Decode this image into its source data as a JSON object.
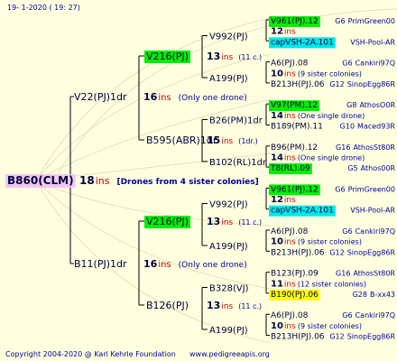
{
  "header": {
    "date": "19-   1-2020  ( 19:  27)"
  },
  "footer": {
    "copyright": "Copyright 2004-2020 @ Karl Kehrle Foundation",
    "url": "www.pedigreeapis.org"
  },
  "colors": {
    "text_dark": "#000040",
    "red": "#cc0000",
    "blue": "#000099",
    "green_hl": "#00ee00",
    "cyan_hl": "#00e8e8",
    "yellow_hl": "#ffff00",
    "root_hl": "#f0c8f0",
    "line": "#000000"
  },
  "root": {
    "label": "B860(CLM)",
    "ins": "18",
    "ins_label": "ins",
    "note": "[Drones from 4 sister colonies]"
  },
  "gen1": [
    {
      "label": "V22(PJ)1dr",
      "ins": "16",
      "ins_label": "ins",
      "note": "(Only one drone)"
    },
    {
      "label": "B11(PJ)1dr",
      "ins": "16",
      "ins_label": "ins",
      "note": "(Only one drone)"
    }
  ],
  "gen2": [
    {
      "label": "V216(PJ)",
      "ins": "13",
      "ins_label": "ins",
      "note": "(11 c.)",
      "hl": "green"
    },
    {
      "label": "B595(ABR)1dr",
      "ins": "15",
      "ins_label": "ins",
      "note": "(1dr.)"
    },
    {
      "label": "V216(PJ)",
      "ins": "13",
      "ins_label": "ins",
      "note": "(11 c.)",
      "hl": "green"
    },
    {
      "label": "B126(PJ)",
      "ins": "13",
      "ins_label": "ins",
      "note": "(11 c.)"
    }
  ],
  "gen3": [
    {
      "label": "V992(PJ)",
      "ins": "12",
      "ins_label": "ins"
    },
    {
      "label": "A199(PJ)",
      "ins": "10",
      "ins_label": "ins",
      "note": "(9 sister colonies)"
    },
    {
      "label": "B26(PM)1dr",
      "ins": "14",
      "ins_label": "ins",
      "note": "(One single drone)"
    },
    {
      "label": "B102(RL)1dr",
      "ins": "14",
      "ins_label": "ins",
      "note": "(One single drone)"
    },
    {
      "label": "V992(PJ)",
      "ins": "12",
      "ins_label": "ins"
    },
    {
      "label": "A199(PJ)",
      "ins": "10",
      "ins_label": "ins",
      "note": "(9 sister colonies)"
    },
    {
      "label": "B328(VJ)",
      "ins": "11",
      "ins_label": "ins",
      "note": "(12 sister colonies)"
    },
    {
      "label": "A199(PJ)",
      "ins": "10",
      "ins_label": "ins",
      "note": "(9 sister colonies)"
    }
  ],
  "gen4": [
    {
      "label": "V961(PJ).12",
      "hl": "green",
      "gen": "G6",
      "source": "PrimGreen00"
    },
    {
      "label": "capVSH-2A.101",
      "hl": "cyan",
      "gen": "",
      "source": "VSH-Pool-AR"
    },
    {
      "label": "A6(PJ).08",
      "gen": "G6",
      "source": "Cankiri97Q"
    },
    {
      "label": "B213H(PJ).06",
      "gen": "G12",
      "source": "SinopEgg86R"
    },
    {
      "label": "V97(PM).12",
      "hl": "green",
      "gen": "G8",
      "source": "AthosO0R"
    },
    {
      "label": "B189(PM).11",
      "gen": "G10",
      "source": "Maced93R"
    },
    {
      "label": "B96(PM).12",
      "gen": "G16",
      "source": "AthosSt80R"
    },
    {
      "label": "T8(RL).09",
      "hl": "green",
      "gen": "G5",
      "source": "Athos00R"
    },
    {
      "label": "V961(PJ).12",
      "hl": "green",
      "gen": "G6",
      "source": "PrimGreen00"
    },
    {
      "label": "capVSH-2A.101",
      "hl": "cyan",
      "gen": "",
      "source": "VSH-Pool-AR"
    },
    {
      "label": "A6(PJ).08",
      "gen": "G6",
      "source": "Cankiri97Q"
    },
    {
      "label": "B213H(PJ).06",
      "gen": "G12",
      "source": "SinopEgg86R"
    },
    {
      "label": "B123(PJ).09",
      "gen": "G16",
      "source": "AthosSt80R"
    },
    {
      "label": "B190(PJ).06",
      "hl": "yellow",
      "gen": "G28",
      "source": "B-xx43"
    },
    {
      "label": "A6(PJ).08",
      "gen": "G6",
      "source": "Cankiri97Q"
    },
    {
      "label": "B213H(PJ).06",
      "gen": "G12",
      "source": "SinopEgg86R"
    }
  ]
}
